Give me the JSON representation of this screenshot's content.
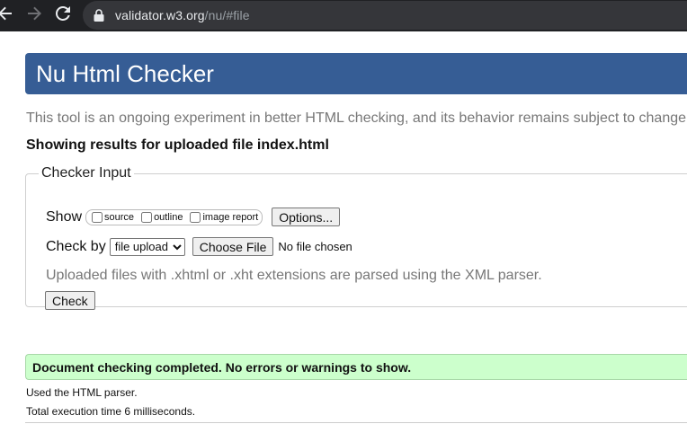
{
  "browser": {
    "url_host": "validator.w3.org",
    "url_path": "/nu/#file",
    "icons": {
      "back": "arrow-left-icon",
      "forward": "arrow-right-icon",
      "reload": "reload-icon",
      "security": "lock-icon"
    }
  },
  "page": {
    "title": "Nu Html Checker",
    "intro": "This tool is an ongoing experiment in better HTML checking, and its behavior remains subject to change",
    "results_heading": "Showing results for uploaded file index.html"
  },
  "checker_input": {
    "legend": "Checker Input",
    "show_label": "Show",
    "options": [
      {
        "label": "source",
        "checked": false
      },
      {
        "label": "outline",
        "checked": false
      },
      {
        "label": "image report",
        "checked": false
      }
    ],
    "options_button": "Options...",
    "check_by_label": "Check by",
    "check_by_selected": "file upload",
    "choose_file_button": "Choose File",
    "no_file_text": "No file chosen",
    "hint": "Uploaded files with .xhtml or .xht extensions are parsed using the XML parser.",
    "check_button": "Check"
  },
  "result": {
    "success_message": "Document checking completed. No errors or warnings to show.",
    "parser_line": "Used the HTML parser.",
    "time_line": "Total execution time 6 milliseconds."
  },
  "colors": {
    "banner": "#365d95",
    "success_bg": "#ccffcc",
    "chrome_bg": "#202124"
  }
}
